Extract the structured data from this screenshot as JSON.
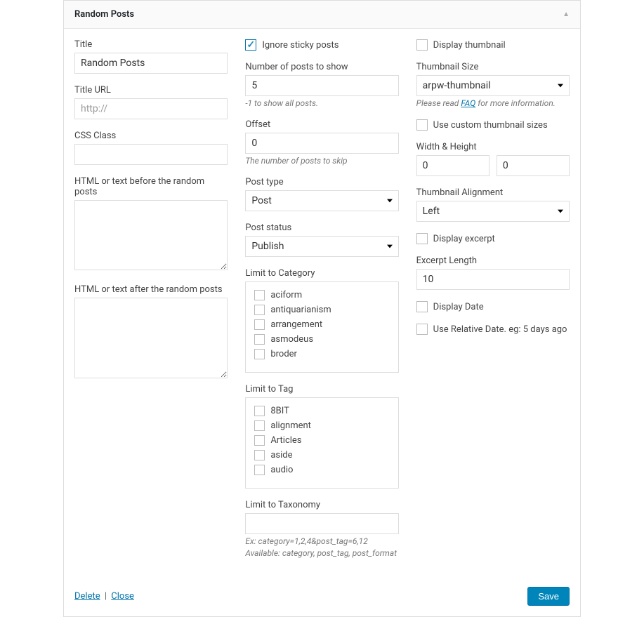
{
  "header": {
    "title": "Random Posts"
  },
  "col1": {
    "title_label": "Title",
    "title_value": "Random Posts",
    "titleurl_label": "Title URL",
    "titleurl_placeholder": "http://",
    "cssclass_label": "CSS Class",
    "before_label": "HTML or text before the random posts",
    "after_label": "HTML or text after the random posts"
  },
  "col2": {
    "ignore_sticky_label": "Ignore sticky posts",
    "num_label": "Number of posts to show",
    "num_value": "5",
    "num_help": "-1 to show all posts.",
    "offset_label": "Offset",
    "offset_value": "0",
    "offset_help": "The number of posts to skip",
    "posttype_label": "Post type",
    "posttype_value": "Post",
    "poststatus_label": "Post status",
    "poststatus_value": "Publish",
    "limitcat_label": "Limit to Category",
    "categories": [
      "aciform",
      "antiquarianism",
      "arrangement",
      "asmodeus",
      "broder"
    ],
    "limittag_label": "Limit to Tag",
    "tags": [
      "8BIT",
      "alignment",
      "Articles",
      "aside",
      "audio"
    ],
    "limittax_label": "Limit to Taxonomy",
    "limittax_help1": "Ex: category=1,2,4&post_tag=6,12",
    "limittax_help2": "Available: category, post_tag, post_format"
  },
  "col3": {
    "display_thumb_label": "Display thumbnail",
    "thumbsize_label": "Thumbnail Size",
    "thumbsize_value": "arpw-thumbnail",
    "thumbsize_help_pre": "Please read ",
    "thumbsize_help_link": "FAQ",
    "thumbsize_help_post": " for more information.",
    "usecustom_label": "Use custom thumbnail sizes",
    "wh_label": "Width & Height",
    "width_value": "0",
    "height_value": "0",
    "align_label": "Thumbnail Alignment",
    "align_value": "Left",
    "display_excerpt_label": "Display excerpt",
    "excerpt_length_label": "Excerpt Length",
    "excerpt_length_value": "10",
    "display_date_label": "Display Date",
    "use_relative_label": "Use Relative Date. eg: 5 days ago"
  },
  "footer": {
    "delete": "Delete",
    "close": "Close",
    "save": "Save"
  }
}
